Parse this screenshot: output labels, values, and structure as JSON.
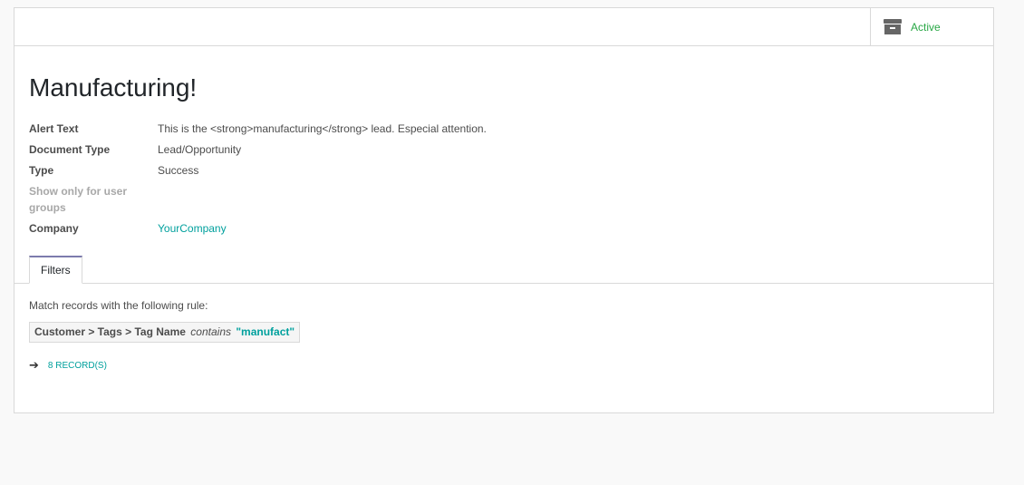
{
  "button_box": {
    "active_label": "Active",
    "icon": "archive-icon"
  },
  "record": {
    "title": "Manufacturing!",
    "fields": [
      {
        "label": "Alert Text",
        "value": "This is the <strong>manufacturing</strong> lead. Especial attention."
      },
      {
        "label": "Document Type",
        "value": "Lead/Opportunity"
      },
      {
        "label": "Type",
        "value": "Success"
      },
      {
        "label": "Show only for user groups",
        "value": ""
      },
      {
        "label": "Company",
        "value": "YourCompany"
      }
    ]
  },
  "tabs": [
    {
      "label": "Filters"
    }
  ],
  "filters": {
    "rule_text": "Match records with the following rule:",
    "domain_path": "Customer > Tags > Tag Name",
    "domain_operator": "contains",
    "domain_value": "\"manufact\"",
    "records_link": "8 RECORD(S)",
    "arrow_icon": "arrow-right-icon"
  },
  "colors": {
    "active": "#28a745",
    "link": "#00a09d",
    "tab_accent": "#7c7bad"
  }
}
